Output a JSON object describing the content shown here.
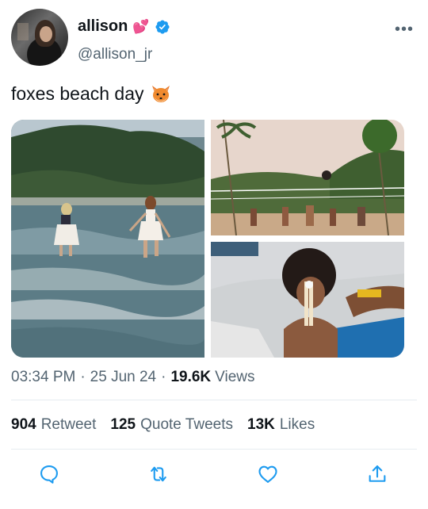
{
  "author": {
    "display_name": "allison",
    "name_emoji": "💕",
    "handle": "@allison_jr",
    "verified": true
  },
  "tweet": {
    "text": "foxes beach day",
    "emoji": "🦊"
  },
  "meta": {
    "time": "03:34 PM",
    "date": "25 Jun 24",
    "views_count": "19.6K",
    "views_label": "Views"
  },
  "stats": {
    "retweets_count": "904",
    "retweets_label": "Retweet",
    "quotes_count": "125",
    "quotes_label": "Quote Tweets",
    "likes_count": "13K",
    "likes_label": "Likes"
  },
  "colors": {
    "verified_blue": "#1d9bf0",
    "secondary_text": "#536471",
    "icon_color": "#1d9bf0"
  },
  "icons": {
    "more": "more-dots-icon",
    "reply": "reply-icon",
    "retweet": "retweet-icon",
    "like": "heart-icon",
    "share": "share-icon"
  }
}
